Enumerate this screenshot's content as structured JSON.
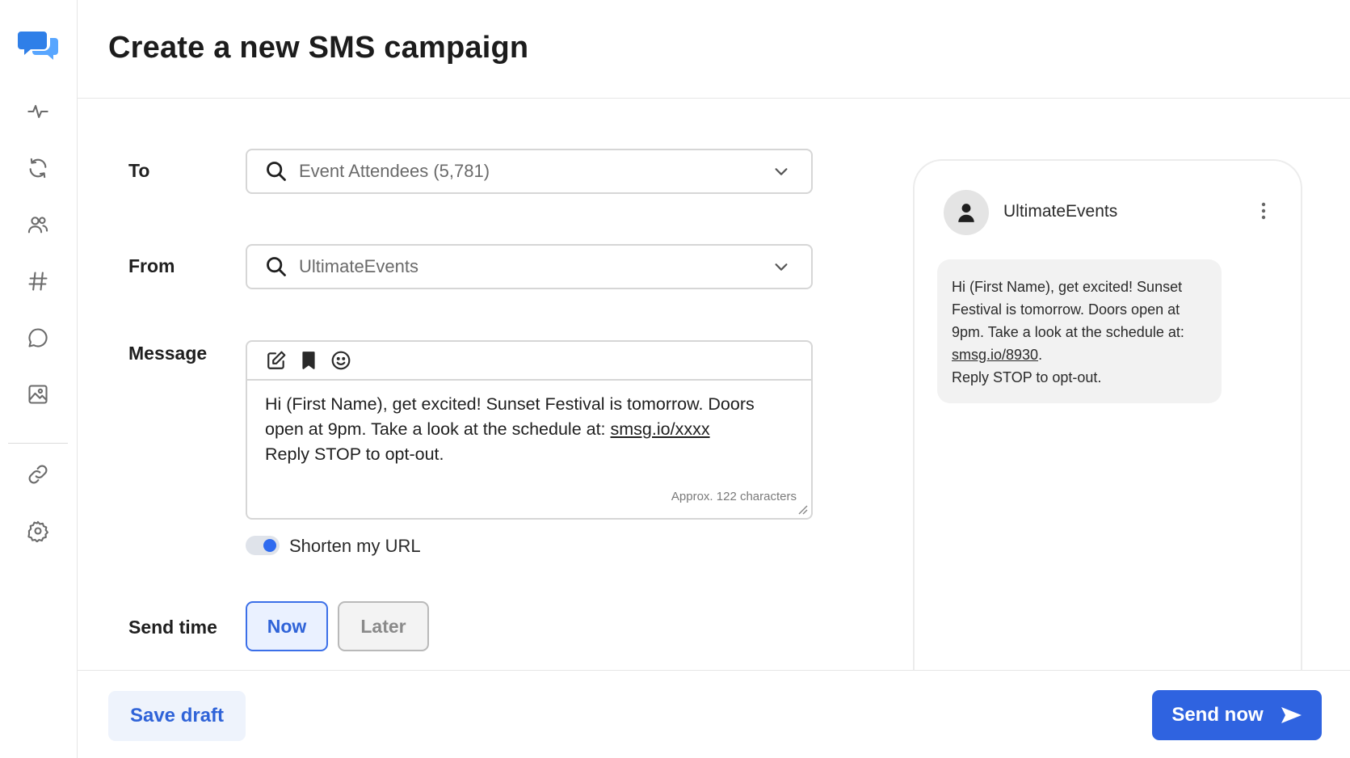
{
  "app": {
    "logo_icon": "chat-bubbles-icon",
    "accent": "#2f63e0"
  },
  "sidebar": {
    "items": [
      {
        "icon": "activity-icon"
      },
      {
        "icon": "refresh-icon"
      },
      {
        "icon": "users-icon"
      },
      {
        "icon": "hashtag-icon"
      },
      {
        "icon": "message-icon"
      },
      {
        "icon": "image-icon"
      },
      {
        "icon": "link-icon"
      },
      {
        "icon": "settings-icon"
      }
    ]
  },
  "header": {
    "title": "Create a new SMS campaign"
  },
  "form": {
    "to": {
      "label": "To",
      "value": "Event Attendees (5,781)"
    },
    "from": {
      "label": "From",
      "value": "UltimateEvents"
    },
    "message": {
      "label": "Message",
      "text_line1": "Hi (First Name), get excited! Sunset Festival is tomorrow. Doors",
      "text_line2_prefix": "open at 9pm. Take a look at the schedule at: ",
      "text_link": "smsg.io/xxxx",
      "text_line3": "Reply STOP to opt-out.",
      "char_count": "Approx. 122 characters"
    },
    "shorten_url": {
      "label": "Shorten my URL",
      "enabled": true
    },
    "send_time": {
      "label": "Send time",
      "options": [
        "Now",
        "Later"
      ],
      "selected": "Now"
    }
  },
  "preview": {
    "sender": "UltimateEvents",
    "line1": "Hi (First Name), get excited! Sunset",
    "line2": "Festival is tomorrow. Doors open at",
    "line3": "9pm. Take a look at the schedule at:",
    "link": "smsg.io/8930",
    "link_suffix": ".",
    "line5": "Reply STOP to opt-out."
  },
  "footer": {
    "save_draft": "Save draft",
    "send_now": "Send now"
  }
}
